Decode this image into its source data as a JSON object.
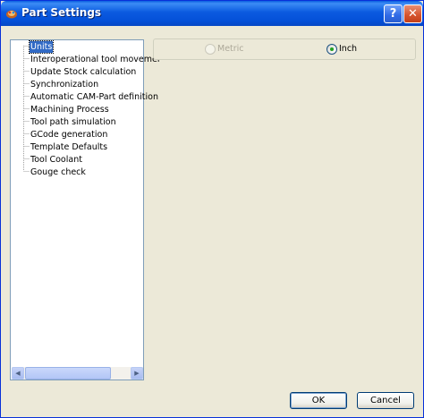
{
  "window": {
    "title": "Part Settings",
    "help_label": "?",
    "close_label": "✕"
  },
  "tree": {
    "items": [
      {
        "label": "Units",
        "selected": true
      },
      {
        "label": "Interoperational tool movemer"
      },
      {
        "label": "Update Stock calculation"
      },
      {
        "label": "Synchronization"
      },
      {
        "label": "Automatic CAM-Part definition"
      },
      {
        "label": "Machining Process"
      },
      {
        "label": "Tool path simulation"
      },
      {
        "label": "GCode generation"
      },
      {
        "label": "Template Defaults"
      },
      {
        "label": "Tool Coolant"
      },
      {
        "label": "Gouge check"
      }
    ]
  },
  "units": {
    "metric_label": "Metric",
    "inch_label": "Inch",
    "selected": "Inch"
  },
  "buttons": {
    "ok": "OK",
    "cancel": "Cancel"
  },
  "colors": {
    "title_bar": "#0a5fe0",
    "selection": "#316ac5",
    "dialog_bg": "#ece9d8"
  }
}
